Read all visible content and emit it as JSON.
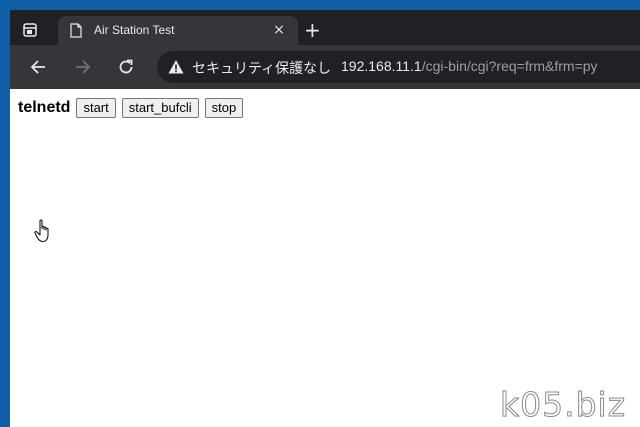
{
  "browser": {
    "tab": {
      "title": "Air Station Test",
      "close_glyph": "×",
      "favicon": "page-icon"
    },
    "new_tab_glyph": "+",
    "nav": {
      "back": "arrow-left-icon",
      "forward": "arrow-right-icon",
      "reload": "reload-icon"
    },
    "omnibox": {
      "security_text": "セキュリティ保護なし",
      "url_host": "192.168.11.1",
      "url_path": "/cgi-bin/cgi?req=frm&frm=py"
    }
  },
  "page": {
    "heading": "telnetd",
    "buttons": [
      {
        "label": "start"
      },
      {
        "label": "start_bufcli"
      },
      {
        "label": "stop"
      }
    ]
  },
  "watermark": "k05.biz",
  "colors": {
    "tabstrip": "#202124",
    "toolbar": "#35363a",
    "omnibox": "#202124",
    "desktop": "#0f5ea8",
    "text_light": "#e8eaed",
    "text_dim": "#9aa0a6"
  }
}
